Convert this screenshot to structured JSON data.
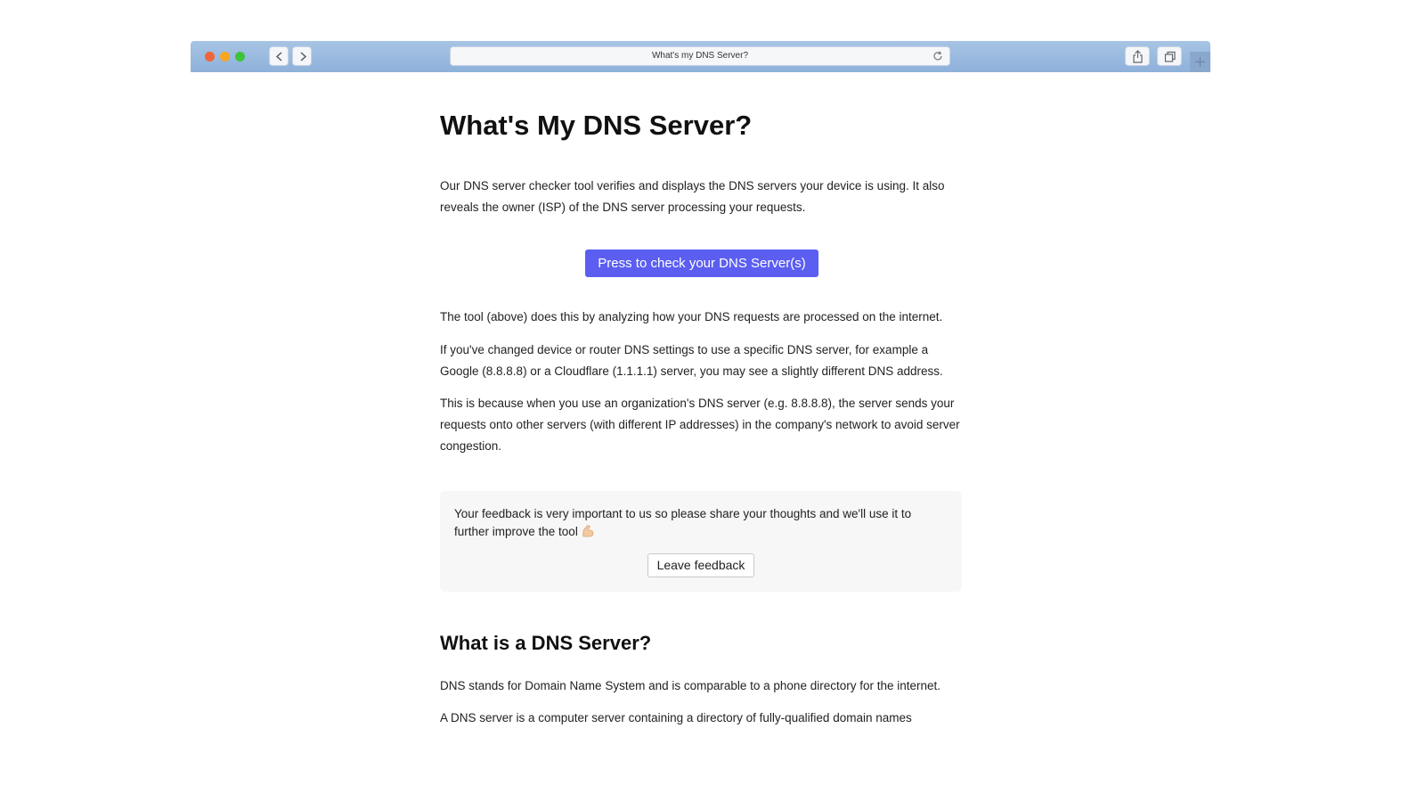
{
  "browser": {
    "address_text": "What's my DNS Server?",
    "accent_color": "#5b5ef0"
  },
  "page": {
    "title": "What's My DNS Server?",
    "intro": "Our DNS server checker tool verifies and displays the DNS servers your device is using. It also reveals the owner (ISP) of the DNS server processing your requests.",
    "check_button_label": "Press to check your DNS Server(s)",
    "para_tool": "The tool (above) does this by analyzing how your DNS requests are processed on the internet.",
    "para_changed": "If you've changed device or router DNS settings to use a specific DNS server, for example a Google (8.8.8.8) or a Cloudflare (1.1.1.1) server, you may see a slightly different DNS address.",
    "para_because": "This is because when you use an organization's DNS server (e.g. 8.8.8.8), the server sends your requests onto other servers (with different IP addresses) in the company's network to avoid server congestion.",
    "feedback": {
      "text": "Your feedback is very important to us so please share your thoughts and we'll use it to further improve the tool",
      "icon": "flexed-biceps-icon",
      "button_label": "Leave feedback"
    },
    "section_heading": "What is a DNS Server?",
    "para_stands": "DNS stands for Domain Name System and is comparable to a phone directory for the internet.",
    "para_server": "A DNS server is a computer server containing a directory of fully-qualified domain names"
  }
}
